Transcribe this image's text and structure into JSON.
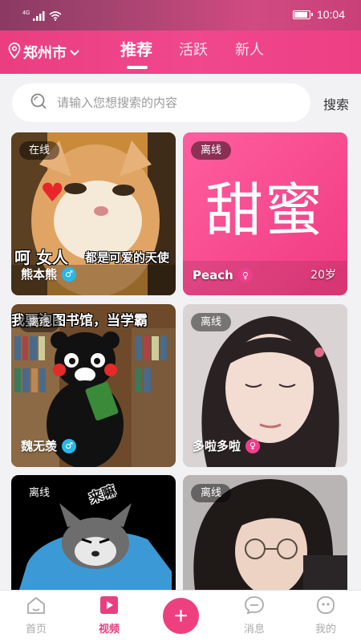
{
  "statusbar": {
    "network": "4G",
    "time": "10:04"
  },
  "header": {
    "city": "郑州市",
    "tabs": [
      {
        "label": "推荐",
        "active": true
      },
      {
        "label": "活跃",
        "active": false
      },
      {
        "label": "新人",
        "active": false
      }
    ]
  },
  "search": {
    "placeholder": "请输入您想搜索的内容",
    "button_label": "搜索"
  },
  "cards": [
    {
      "status": "在线",
      "name": "熊本熊",
      "gender": "male",
      "gender_symbol": "♂",
      "age": "",
      "overlay_text_1": "呵 女人",
      "overlay_text_2": "都是可爱的天使"
    },
    {
      "status": "离线",
      "name": "Peach",
      "gender": "female",
      "gender_symbol": "♀",
      "age": "20岁",
      "overlay_text_1": "甜蜜"
    },
    {
      "status": "离线",
      "name": "魏无羡",
      "gender": "male",
      "gender_symbol": "♂",
      "age": "",
      "overlay_text_1": "我要泡图书馆，当学霸"
    },
    {
      "status": "离线",
      "name": "多啦多啦",
      "gender": "female",
      "gender_symbol": "♀",
      "age": ""
    },
    {
      "status": "离线",
      "name": "",
      "overlay_text_1": "来嘛"
    },
    {
      "status": "离线",
      "name": ""
    }
  ],
  "bottomnav": {
    "items": [
      {
        "label": "首页",
        "icon": "home-icon",
        "active": false
      },
      {
        "label": "视频",
        "icon": "video-icon",
        "active": true
      },
      {
        "label": "消息",
        "icon": "message-icon",
        "active": false
      },
      {
        "label": "我的",
        "icon": "profile-icon",
        "active": false
      }
    ],
    "add_symbol": "+"
  },
  "colors": {
    "accent": "#ea3e80",
    "male": "#26b8e8",
    "female": "#ee3f8c"
  }
}
